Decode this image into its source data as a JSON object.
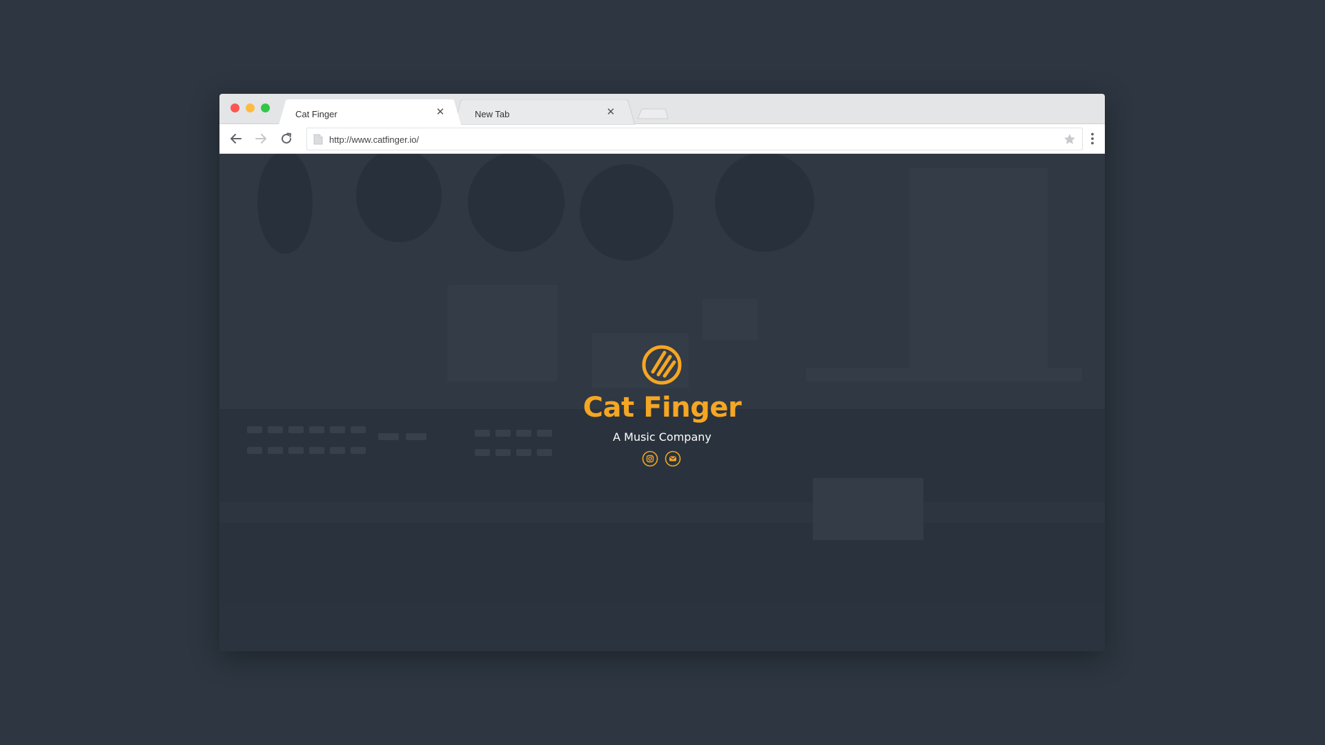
{
  "colors": {
    "desktop_bg": "#2d3641",
    "accent": "#f5a623",
    "traffic_close": "#fc5753",
    "traffic_minimize": "#fdbc40",
    "traffic_maximize": "#33c748"
  },
  "tabs": [
    {
      "title": "Cat Finger",
      "active": true,
      "close_icon": "close-icon"
    },
    {
      "title": "New Tab",
      "active": false,
      "close_icon": "close-icon"
    }
  ],
  "toolbar": {
    "back_icon": "arrow-left-icon",
    "forward_icon": "arrow-right-icon",
    "reload_icon": "reload-icon",
    "url": "http://www.catfinger.io/",
    "bookmark_icon": "star-icon",
    "menu_icon": "kebab-menu-icon"
  },
  "page": {
    "logo_icon": "cat-scratch-logo-icon",
    "title": "Cat Finger",
    "subtitle": "A Music Company",
    "social": [
      {
        "icon": "instagram-icon"
      },
      {
        "icon": "mail-icon"
      }
    ]
  }
}
